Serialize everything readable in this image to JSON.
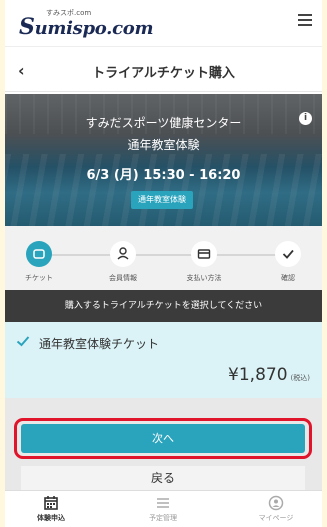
{
  "header": {
    "logo_small": "すみスポ.com",
    "logo_s": "S",
    "logo_rest": "umispo.com",
    "menu_icon": "hamburger-menu-icon"
  },
  "title_bar": {
    "back_icon": "chevron-left-icon",
    "title": "トライアルチケット購入"
  },
  "hero": {
    "facility": "すみだスポーツ健康センター",
    "class_name": "通年教室体験",
    "datetime": "6/3 (月) 15:30 - 16:20",
    "badge": "通年教室体験",
    "info_icon": "info-icon"
  },
  "steps": {
    "items": [
      {
        "label": "チケット",
        "icon": "ticket-icon",
        "active": true
      },
      {
        "label": "会員情報",
        "icon": "person-icon",
        "active": false
      },
      {
        "label": "支払い方法",
        "icon": "credit-card-icon",
        "active": false
      },
      {
        "label": "確認",
        "icon": "checkmark-icon",
        "active": false
      }
    ]
  },
  "prompt": "購入するトライアルチケットを選択してください",
  "ticket": {
    "name": "通年教室体験チケット",
    "price": "¥1,870",
    "tax": "(税込)",
    "selected": true
  },
  "buttons": {
    "next": "次へ",
    "back": "戻る"
  },
  "bottom_nav": {
    "items": [
      {
        "label": "体験申込",
        "icon": "calendar-icon",
        "active": true
      },
      {
        "label": "予定管理",
        "icon": "list-icon",
        "active": false
      },
      {
        "label": "マイページ",
        "icon": "user-icon",
        "active": false
      }
    ]
  },
  "colors": {
    "accent": "#2aa3bd",
    "highlight_outline": "#e0142a",
    "ticket_bg": "#dbf3f7",
    "prompt_bg": "#3b3b3b",
    "page_bg": "#fff8df"
  }
}
